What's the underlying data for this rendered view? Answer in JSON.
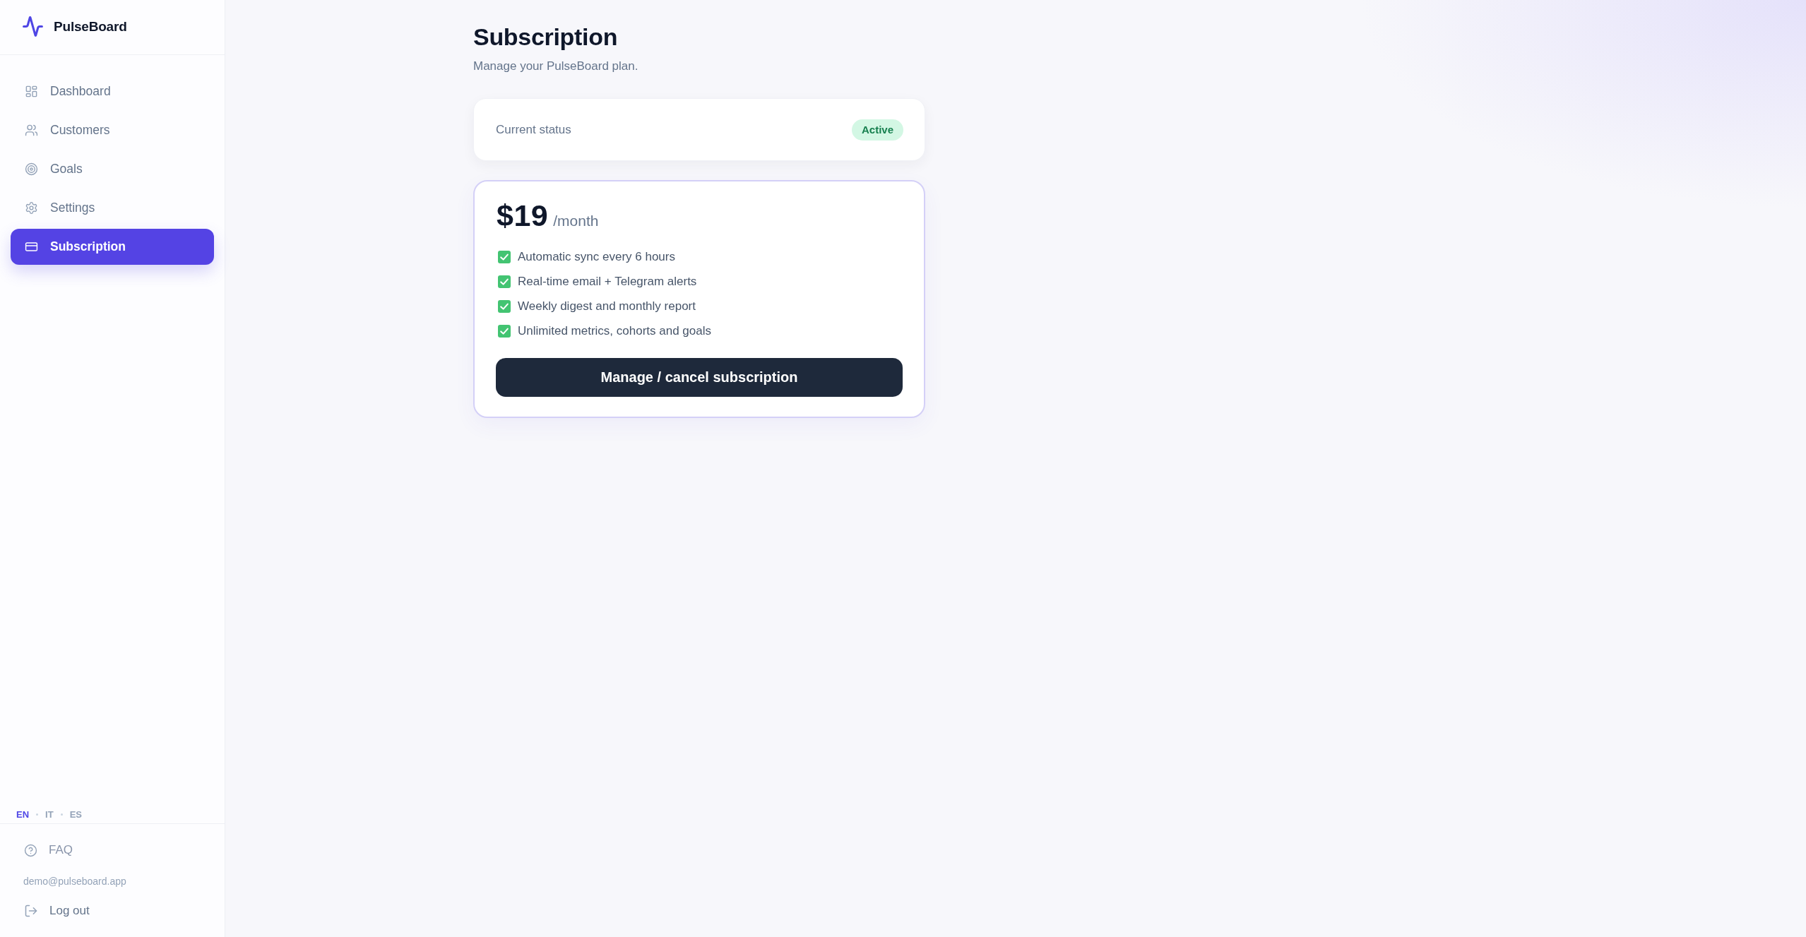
{
  "sidebar": {
    "brand": "PulseBoard",
    "nav": [
      {
        "label": "Dashboard",
        "selected": false
      },
      {
        "label": "Customers",
        "selected": false
      },
      {
        "label": "Goals",
        "selected": false
      },
      {
        "label": "Settings",
        "selected": false
      },
      {
        "label": "Subscription",
        "selected": true
      }
    ],
    "languages": [
      {
        "code": "EN",
        "selected": true
      },
      {
        "code": "IT",
        "selected": false
      },
      {
        "code": "ES",
        "selected": false
      }
    ],
    "footer": {
      "faq": "FAQ",
      "email": "demo@pulseboard.app",
      "logout": "Log out"
    }
  },
  "page": {
    "title": "Subscription",
    "subtitle": "Manage your PulseBoard plan."
  },
  "status_card": {
    "label": "Current status",
    "badge": "Active"
  },
  "plan_card": {
    "price": "$19",
    "period": "/month",
    "features": [
      "Automatic sync every 6 hours",
      "Real-time email + Telegram alerts",
      "Weekly digest and monthly report",
      "Unlimited metrics, cohorts and goals"
    ],
    "button": "Manage / cancel subscription"
  }
}
